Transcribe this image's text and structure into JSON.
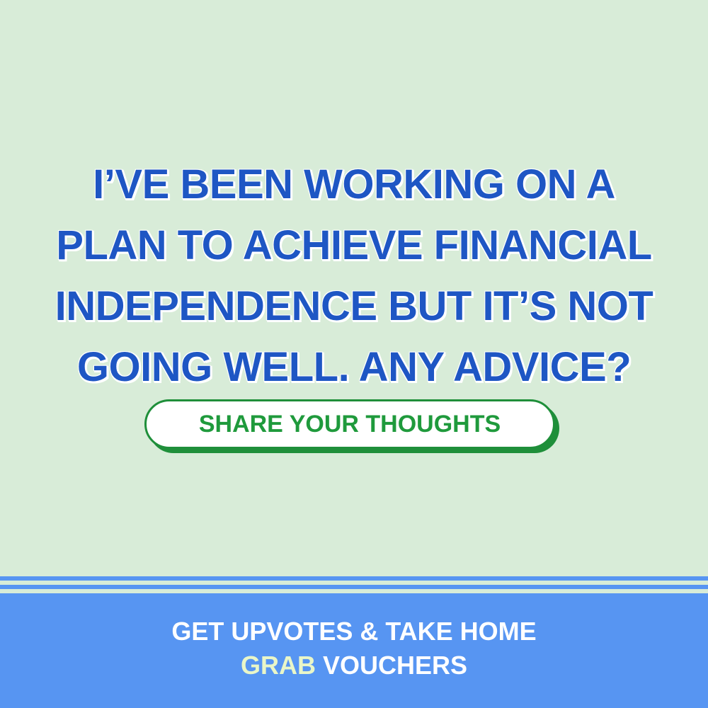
{
  "headline": {
    "lines": [
      "I’VE BEEN WORKING ON A",
      "PLAN TO ACHIEVE FINANCIAL",
      "INDEPENDENCE BUT IT’S NOT",
      "GOING WELL. ANY ADVICE?"
    ]
  },
  "cta": {
    "label": "SHARE YOUR THOUGHTS"
  },
  "footer": {
    "line1": "GET UPVOTES & TAKE HOME",
    "line2_highlight": "GRAB",
    "line2_rest": "VOUCHERS"
  },
  "colors": {
    "background": "#d8ecd8",
    "headline": "#1e56c4",
    "cta_text": "#1f9a3c",
    "footer_bg": "#5795f2"
  }
}
